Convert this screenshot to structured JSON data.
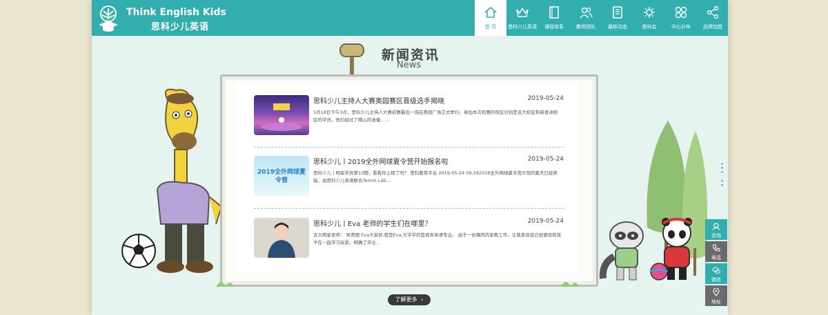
{
  "brand": {
    "name_en": "Think English Kids",
    "name_cn": "思科少儿英语"
  },
  "nav": [
    {
      "label": "首 页",
      "icon": "home-icon",
      "active": true
    },
    {
      "label": "思科少儿英语",
      "icon": "crown-icon"
    },
    {
      "label": "课程体系",
      "icon": "book-icon"
    },
    {
      "label": "教师团队",
      "icon": "team-icon"
    },
    {
      "label": "最新动态",
      "icon": "news-icon"
    },
    {
      "label": "思科会",
      "icon": "club-icon"
    },
    {
      "label": "中心分布",
      "icon": "location-grid-icon"
    },
    {
      "label": "品牌加盟",
      "icon": "share-icon"
    }
  ],
  "section": {
    "title_cn": "新闻资讯",
    "title_en": "News"
  },
  "news": [
    {
      "title": "思科少儿主持人大赛奥园赛区晋级选手揭晓",
      "date": "2019-05-24",
      "desc": "5月18日下午3点，思科少儿主持人大赛初赛最后一场在奥园广场正式举行。参加本次初赛的校区分别是吉大校区和新香洲校区的学员。他们经过了精心的准备，..."
    },
    {
      "title": "思科少儿丨2019全外网球夏令营开始报名啦",
      "date": "2019-05-24",
      "desc": "思科少儿丨明星学员第13期，看看你上榜了吗？ 思科教育平台 2019-05-24 09:282019全外网球夏令营炎热的夏天已经来临，由思科少儿英语联合Tennis Lab...",
      "thumb_text": "2019全外网球夏令营"
    },
    {
      "title": "思科少儿丨Eva 老师的学生们在哪里？",
      "date": "2019-05-24",
      "desc": "吉大明星老师： 吴青丽 Eva大家好,我是Eva,大学学的是商务英语专业。 由于一份偶然的家教工作，让我发现自己很喜欢和孩子在一起学习玩耍，明确了毕业..."
    }
  ],
  "more_button": "了解更多",
  "side_tools": [
    {
      "label": "咨询",
      "icon": "consult-icon"
    },
    {
      "label": "电话",
      "icon": "phone-icon"
    },
    {
      "label": "微信",
      "icon": "wechat-icon"
    },
    {
      "label": "地址",
      "icon": "map-pin-icon"
    }
  ],
  "colors": {
    "brand": "#32aeae",
    "page_bg": "#e6f4ef",
    "outer_bg": "#ebe6cf",
    "button_dark": "#3a3a3a"
  }
}
